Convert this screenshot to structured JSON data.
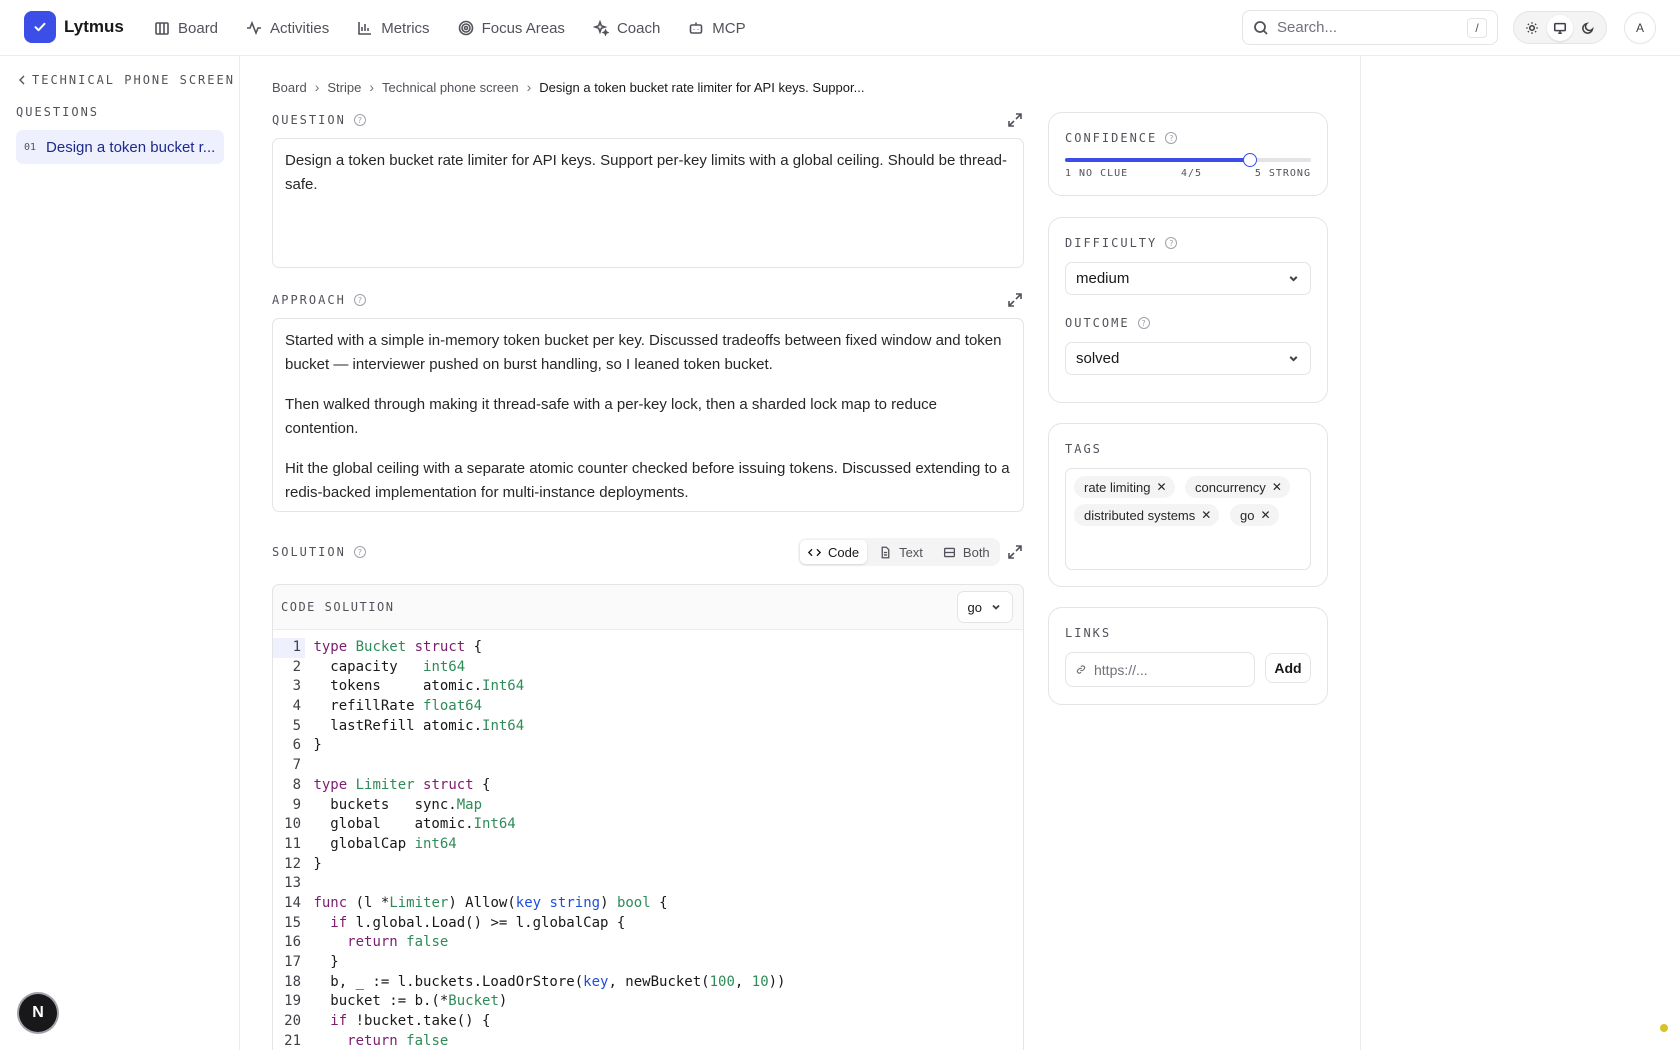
{
  "app": {
    "name": "Lytmus"
  },
  "nav": [
    {
      "label": "Board",
      "icon": "board-icon"
    },
    {
      "label": "Activities",
      "icon": "activity-icon"
    },
    {
      "label": "Metrics",
      "icon": "chart-icon"
    },
    {
      "label": "Focus Areas",
      "icon": "target-icon"
    },
    {
      "label": "Coach",
      "icon": "sparkle-icon"
    },
    {
      "label": "MCP",
      "icon": "robot-icon"
    }
  ],
  "search": {
    "placeholder": "Search...",
    "shortcut": "/"
  },
  "theme": {
    "options": [
      "light",
      "system",
      "dark"
    ],
    "selected": "system"
  },
  "user": {
    "initial": "A"
  },
  "sidebar": {
    "back_label": "TECHNICAL PHONE SCREEN",
    "section_label": "QUESTIONS",
    "items": [
      {
        "number": "01",
        "label": "Design a token bucket r..."
      }
    ]
  },
  "breadcrumb": {
    "items": [
      "Board",
      "Stripe",
      "Technical phone screen"
    ],
    "current": "Design a token bucket rate limiter for API keys. Suppor..."
  },
  "question": {
    "label": "QUESTION",
    "text": "Design a token bucket rate limiter for API keys. Support per-key limits with a global ceiling. Should be thread-safe."
  },
  "approach": {
    "label": "APPROACH",
    "paragraphs": [
      "Started with a simple in-memory token bucket per key. Discussed tradeoffs between fixed window and token bucket — interviewer pushed on burst handling, so I leaned token bucket.",
      "Then walked through making it thread-safe with a per-key lock, then a sharded lock map to reduce contention.",
      "Hit the global ceiling with a separate atomic counter checked before issuing tokens. Discussed extending to a redis-backed implementation for multi-instance deployments."
    ]
  },
  "solution": {
    "label": "SOLUTION",
    "modes": [
      "Code",
      "Text",
      "Both"
    ],
    "selected_mode": "Code",
    "code_title": "CODE SOLUTION",
    "language": "go",
    "active_line": 1,
    "lines": [
      "type Bucket struct {",
      "  capacity   int64",
      "  tokens     atomic.Int64",
      "  refillRate float64",
      "  lastRefill atomic.Int64",
      "}",
      "",
      "type Limiter struct {",
      "  buckets   sync.Map",
      "  global    atomic.Int64",
      "  globalCap int64",
      "}",
      "",
      "func (l *Limiter) Allow(key string) bool {",
      "  if l.global.Load() >= l.globalCap {",
      "    return false",
      "  }",
      "  b, _ := l.buckets.LoadOrStore(key, newBucket(100, 10))",
      "  bucket := b.(*Bucket)",
      "  if !bucket.take() {",
      "    return false",
      "  }"
    ]
  },
  "confidence": {
    "label": "CONFIDENCE",
    "value": 4,
    "max": 5,
    "low_label": "1 NO CLUE",
    "value_label": "4/5",
    "high_label": "5 STRONG"
  },
  "difficulty": {
    "label": "DIFFICULTY",
    "value": "medium"
  },
  "outcome": {
    "label": "OUTCOME",
    "value": "solved"
  },
  "tags": {
    "label": "TAGS",
    "items": [
      "rate limiting",
      "concurrency",
      "distributed systems",
      "go"
    ]
  },
  "links": {
    "label": "LINKS",
    "placeholder": "https://...",
    "add_label": "Add"
  },
  "fab": {
    "label": "N"
  },
  "colors": {
    "accent": "#3b4ee8",
    "accent_soft": "#eef0fd"
  }
}
